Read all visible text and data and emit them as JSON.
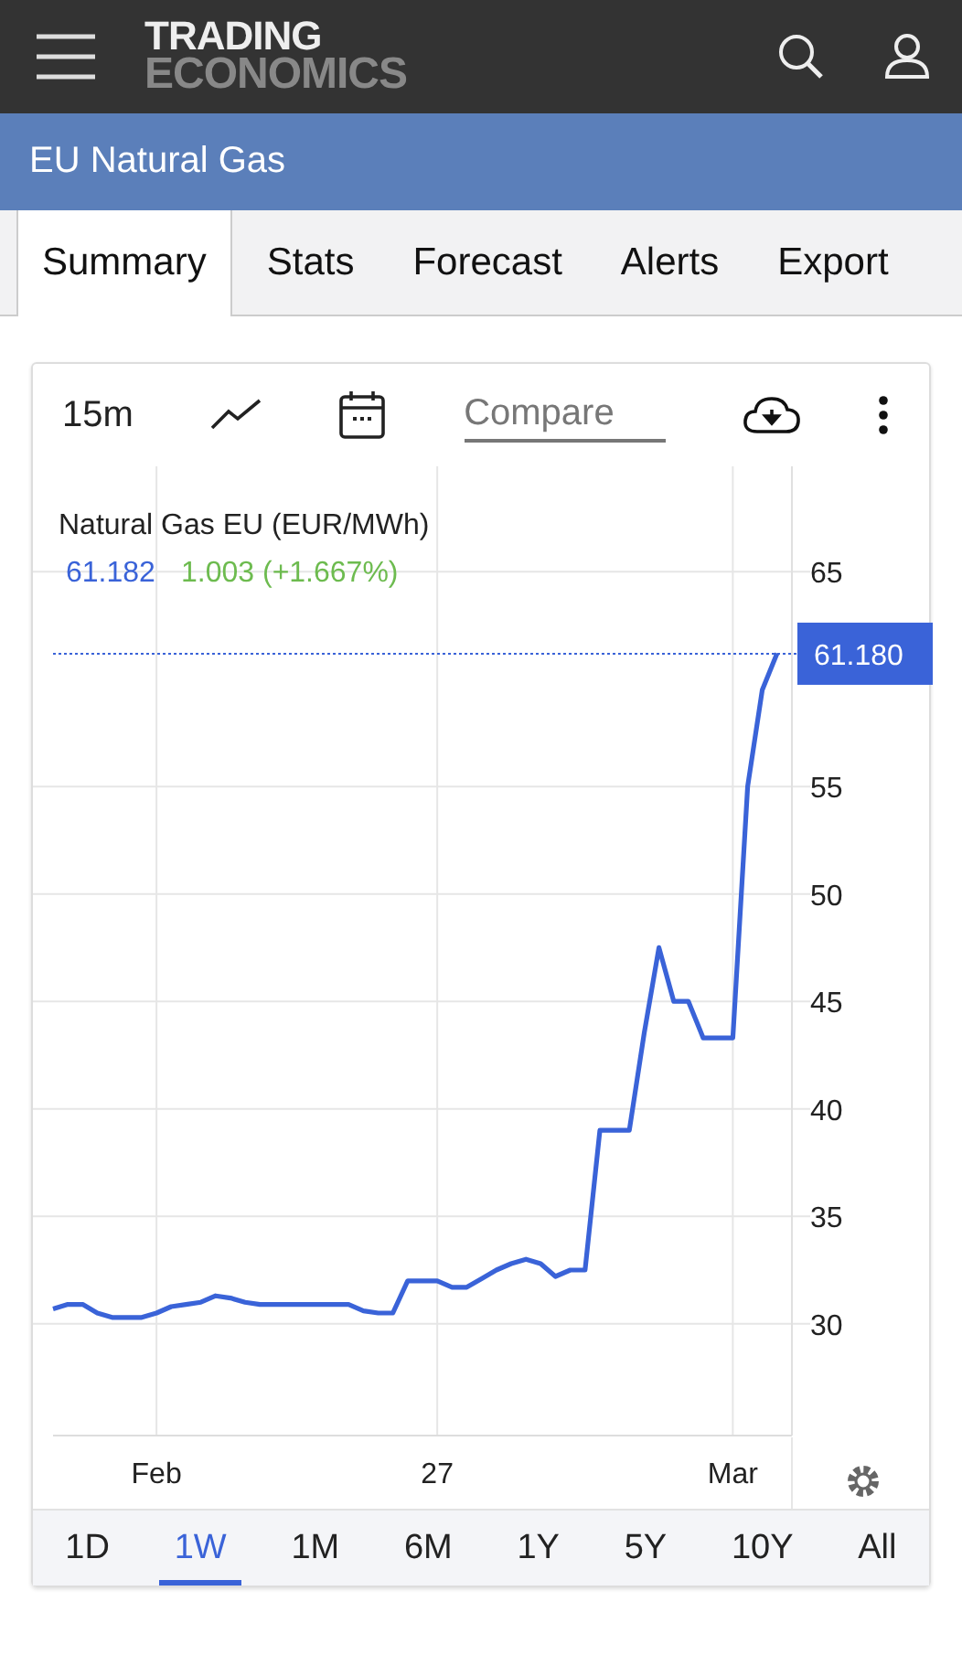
{
  "header": {
    "logo_top": "TRADING",
    "logo_bottom": "ECONOMICS"
  },
  "title_bar": {
    "title": "EU Natural Gas"
  },
  "tabs": [
    {
      "label": "Summary",
      "selected": true
    },
    {
      "label": "Stats",
      "selected": false
    },
    {
      "label": "Forecast",
      "selected": false
    },
    {
      "label": "Alerts",
      "selected": false
    },
    {
      "label": "Export",
      "selected": false
    }
  ],
  "toolbar": {
    "interval": "15m",
    "compare": {
      "placeholder": "Compare"
    }
  },
  "legend": {
    "name": "Natural Gas EU (EUR/MWh)",
    "last": "61.182",
    "change": "1.003 (+1.667%)"
  },
  "chart_data": {
    "type": "line",
    "categories": [
      null,
      null,
      null,
      null,
      null,
      null,
      null,
      "Feb",
      null,
      null,
      null,
      null,
      null,
      null,
      null,
      null,
      null,
      null,
      null,
      null,
      null,
      null,
      null,
      null,
      null,
      null,
      "27",
      null,
      null,
      null,
      null,
      null,
      null,
      null,
      null,
      null,
      null,
      null,
      null,
      null,
      null,
      null,
      null,
      null,
      null,
      null,
      "Mar",
      null,
      null,
      null
    ],
    "series": [
      {
        "color": "#3a63d8",
        "values": [
          30.7,
          30.9,
          30.9,
          30.5,
          30.3,
          30.3,
          30.3,
          30.5,
          30.8,
          30.9,
          31,
          31.3,
          31.2,
          31,
          30.9,
          30.9,
          30.9,
          30.9,
          30.9,
          30.9,
          30.9,
          30.6,
          30.5,
          30.5,
          32,
          32,
          32,
          31.7,
          31.7,
          32.1,
          32.5,
          32.8,
          33,
          32.8,
          32.2,
          32.5,
          32.5,
          39,
          39,
          39,
          43.5,
          47.5,
          45,
          45,
          43.3,
          43.3,
          43.3,
          55,
          59.5,
          61.2
        ]
      }
    ],
    "yticks": [
      30,
      35,
      40,
      45,
      50,
      55,
      65
    ],
    "ylim": [
      24.8,
      69.9
    ],
    "grid": true,
    "ref_lines": [
      {
        "axis": "y",
        "value": 61.18,
        "label": "61.180",
        "color": "#3a63d8"
      }
    ]
  },
  "ranges": [
    {
      "label": "1D",
      "selected": false
    },
    {
      "label": "1W",
      "selected": true
    },
    {
      "label": "1M",
      "selected": false
    },
    {
      "label": "6M",
      "selected": false
    },
    {
      "label": "1Y",
      "selected": false
    },
    {
      "label": "5Y",
      "selected": false
    },
    {
      "label": "10Y",
      "selected": false
    },
    {
      "label": "All",
      "selected": false
    }
  ]
}
